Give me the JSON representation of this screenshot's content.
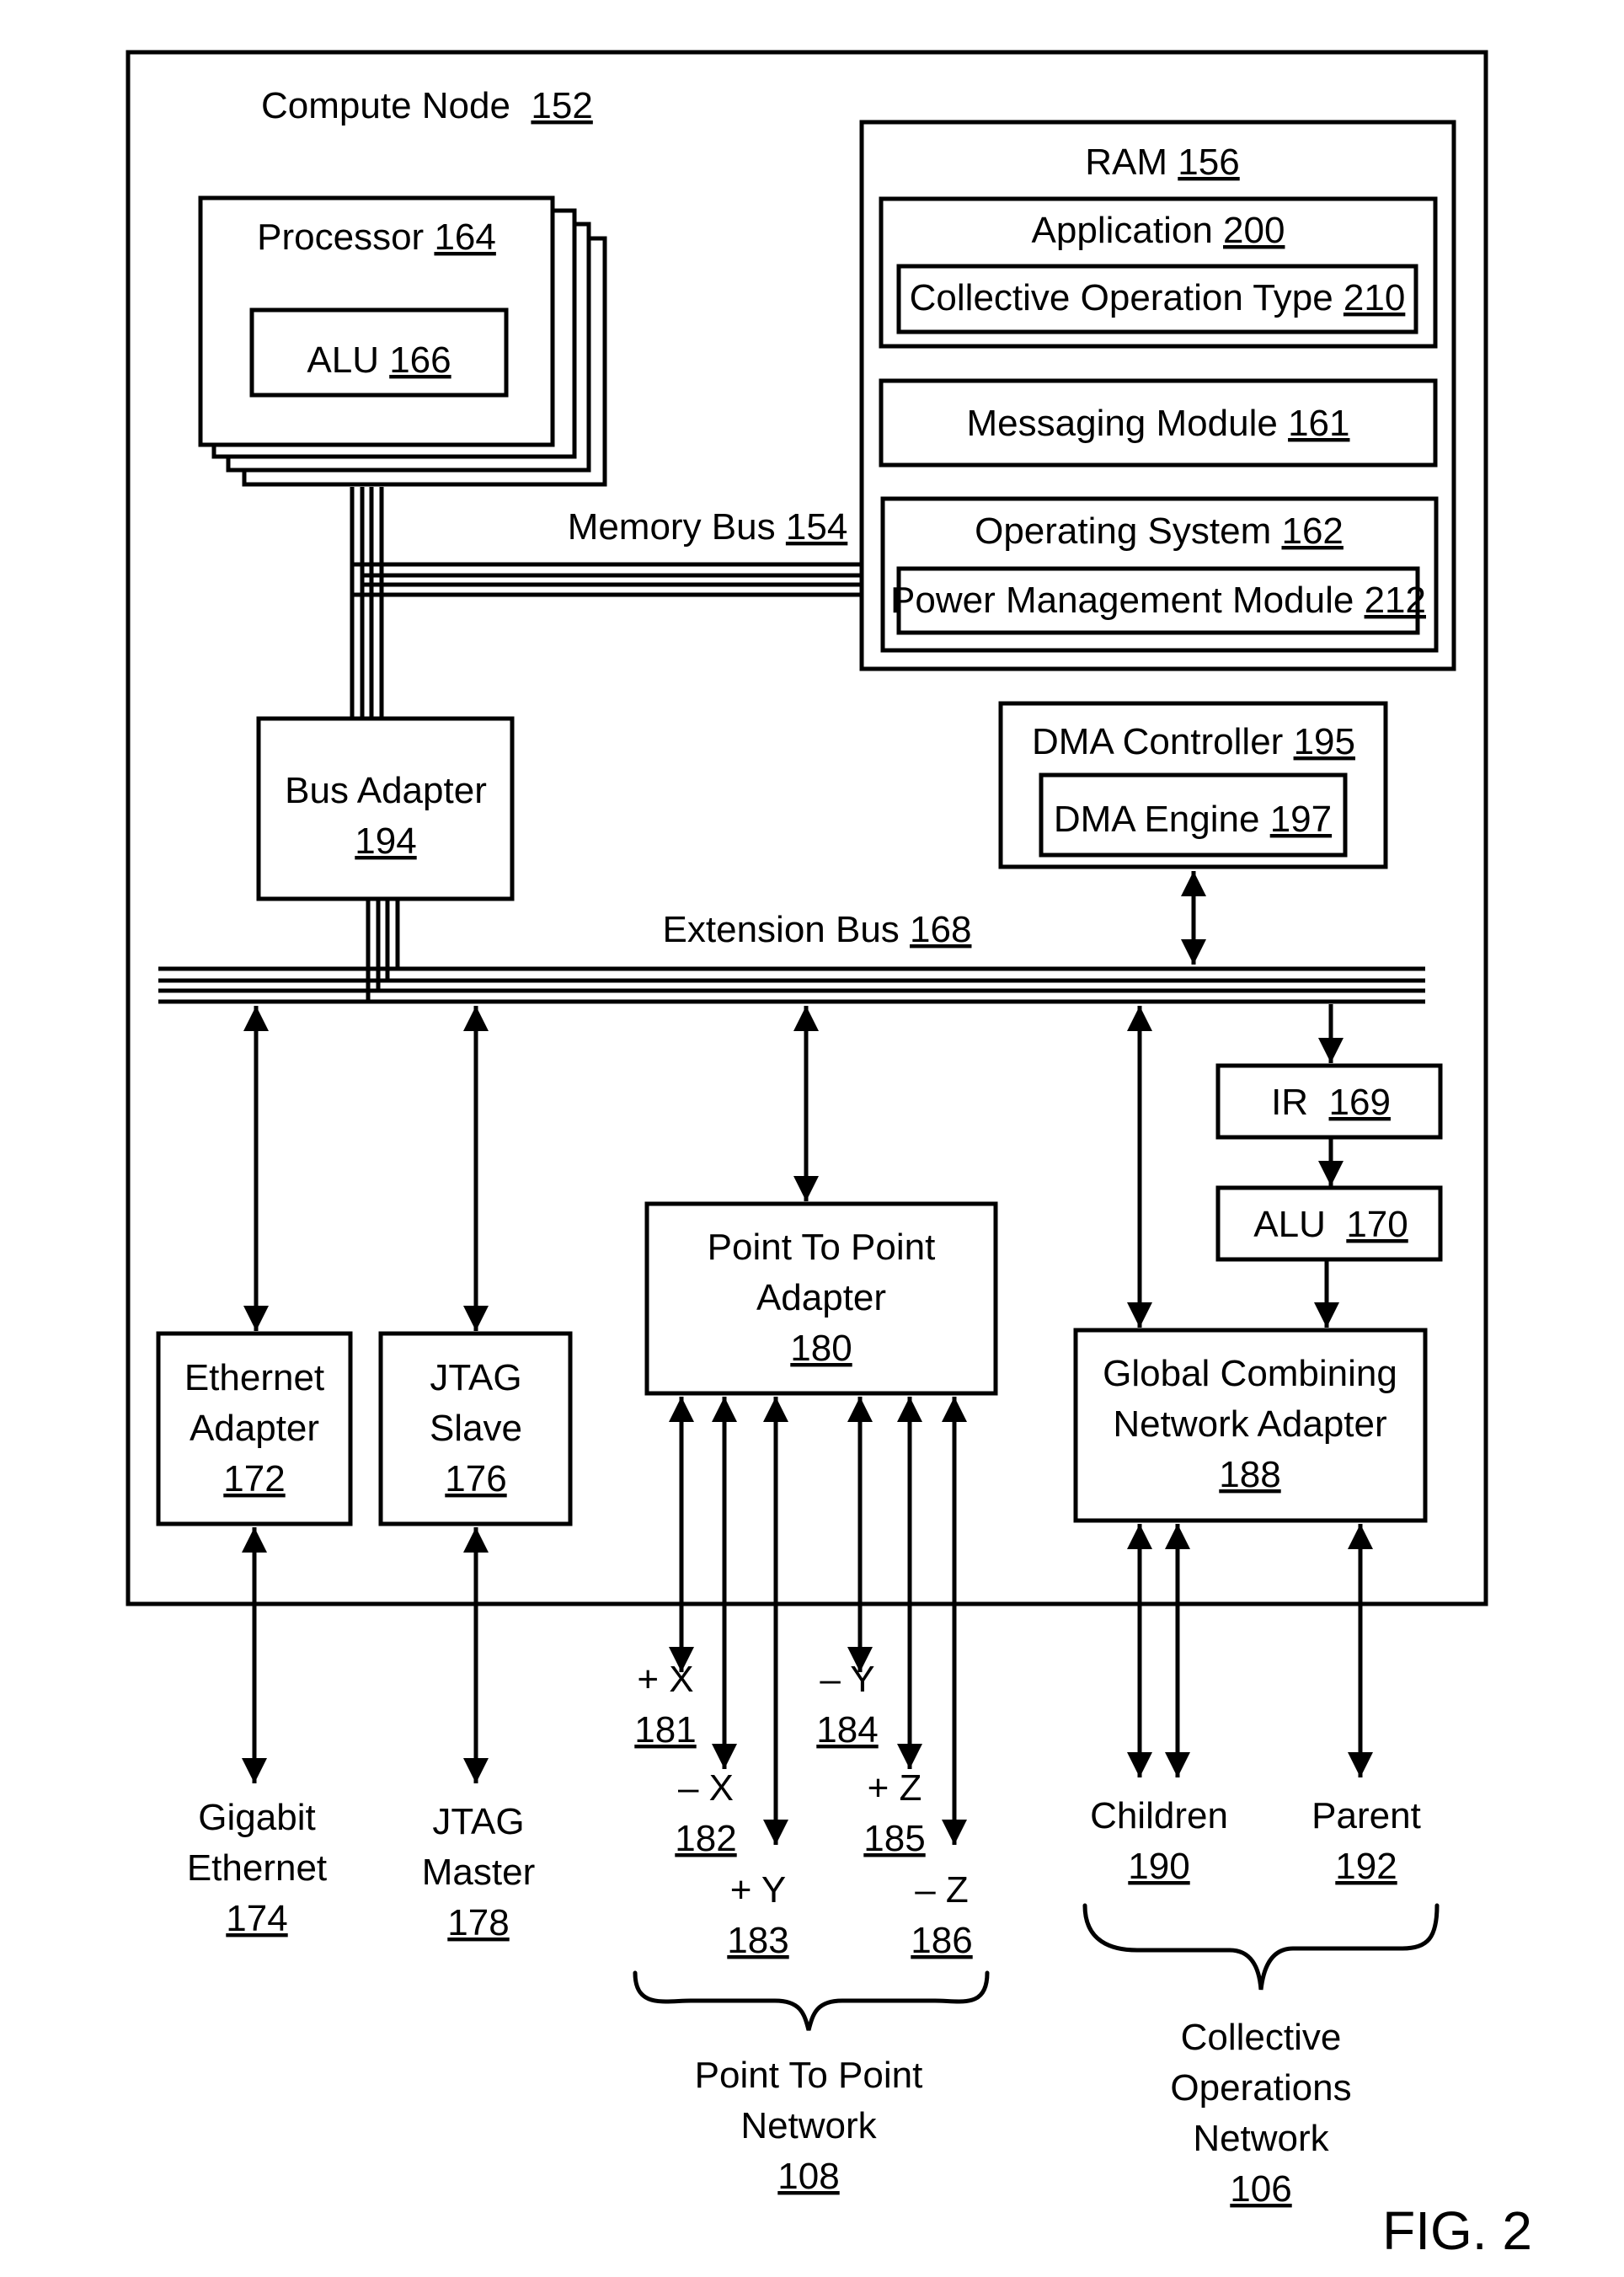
{
  "figure": {
    "label": "FIG. 2",
    "compute_node": {
      "name": "Compute Node",
      "ref": "152"
    },
    "processor": {
      "name": "Processor",
      "ref": "164",
      "alu": {
        "name": "ALU",
        "ref": "166"
      }
    },
    "memory_bus": {
      "name": "Memory Bus",
      "ref": "154"
    },
    "ram": {
      "name": "RAM",
      "ref": "156",
      "application": {
        "name": "Application",
        "ref": "200",
        "collective_operation_type": {
          "name": "Collective Operation Type",
          "ref": "210"
        }
      },
      "messaging_module": {
        "name": "Messaging Module",
        "ref": "161"
      },
      "operating_system": {
        "name": "Operating System",
        "ref": "162",
        "power_management_module": {
          "name": "Power Management Module",
          "ref": "212"
        }
      }
    },
    "bus_adapter": {
      "name": "Bus Adapter",
      "ref": "194"
    },
    "dma_controller": {
      "name": "DMA Controller",
      "ref": "195",
      "dma_engine": {
        "name": "DMA Engine",
        "ref": "197"
      }
    },
    "extension_bus": {
      "name": "Extension Bus",
      "ref": "168"
    },
    "ir": {
      "name": "IR",
      "ref": "169"
    },
    "alu_170": {
      "name": "ALU",
      "ref": "170"
    },
    "ethernet_adapter": {
      "line1": "Ethernet",
      "line2": "Adapter",
      "ref": "172"
    },
    "jtag_slave": {
      "line1": "JTAG",
      "line2": "Slave",
      "ref": "176"
    },
    "p2p_adapter": {
      "line1": "Point To Point",
      "line2": "Adapter",
      "ref": "180"
    },
    "gcn_adapter": {
      "line1": "Global Combining",
      "line2": "Network Adapter",
      "ref": "188"
    },
    "gigabit_ethernet": {
      "line1": "Gigabit",
      "line2": "Ethernet",
      "ref": "174"
    },
    "jtag_master": {
      "line1": "JTAG",
      "line2": "Master",
      "ref": "178"
    },
    "links": [
      {
        "sign": "+",
        "axis": "X",
        "ref": "181"
      },
      {
        "sign": "–",
        "axis": "X",
        "ref": "182"
      },
      {
        "sign": "+",
        "axis": "Y",
        "ref": "183"
      },
      {
        "sign": "–",
        "axis": "Y",
        "ref": "184"
      },
      {
        "sign": "+",
        "axis": "Z",
        "ref": "185"
      },
      {
        "sign": "–",
        "axis": "Z",
        "ref": "186"
      }
    ],
    "p2p_network": {
      "line1": "Point To Point",
      "line2": "Network",
      "ref": "108"
    },
    "children": {
      "name": "Children",
      "ref": "190"
    },
    "parent": {
      "name": "Parent",
      "ref": "192"
    },
    "collective_network": {
      "line1": "Collective",
      "line2": "Operations",
      "line3": "Network",
      "ref": "106"
    }
  }
}
